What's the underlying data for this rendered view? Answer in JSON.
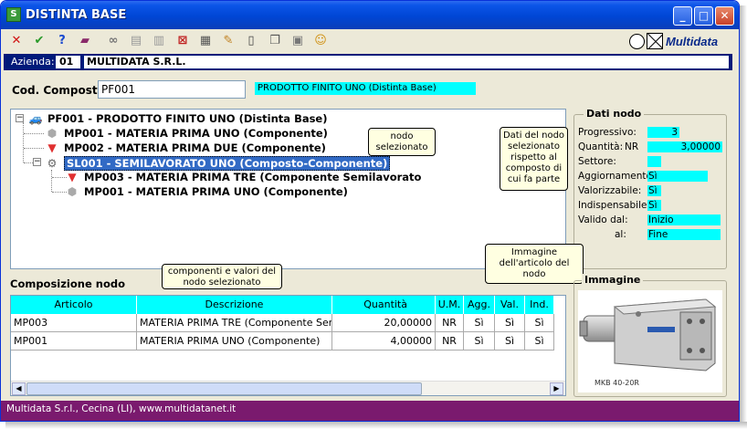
{
  "window": {
    "title": "DISTINTA BASE",
    "app_icon_letter": "S",
    "minimize": "_",
    "maximize": "□",
    "close": "✕"
  },
  "toolbar": {
    "icons": [
      "close-x-icon",
      "checkmark-icon",
      "help-icon",
      "book-icon",
      "binoculars-icon",
      "copy-icon",
      "paste-icon",
      "delete-icon",
      "print-preview-icon",
      "edit-icon",
      "new-document-icon",
      "duplicate-icon",
      "clipboard-icon",
      "palette-icon"
    ],
    "brand": "Multidata"
  },
  "azienda": {
    "label": "Azienda:",
    "code": "01",
    "name": "MULTIDATA S.R.L."
  },
  "composto": {
    "label": "Cod. Composto:",
    "value": "PF001",
    "description": "PRODOTTO FINITO UNO (Distinta Base)"
  },
  "tree": {
    "nodes": [
      {
        "label": "PF001 - PRODOTTO FINITO UNO (Distinta Base)",
        "icon": "car-icon"
      },
      {
        "label": "MP001 - MATERIA PRIMA UNO (Componente)",
        "icon": "cube-icon"
      },
      {
        "label": "MP002 - MATERIA PRIMA DUE (Componente)",
        "icon": "gem-icon"
      },
      {
        "label": "SL001 - SEMILAVORATO UNO (Composto-Componente)",
        "icon": "gear-icon"
      },
      {
        "label": "MP003 - MATERIA PRIMA TRE (Componente Semilavorato",
        "icon": "gem-icon"
      },
      {
        "label": "MP001 - MATERIA PRIMA UNO (Componente)",
        "icon": "cube-icon"
      }
    ],
    "callout": "nodo selezionato"
  },
  "dati_nodo": {
    "title": "Dati nodo",
    "callout": "Dati del nodo selezionato rispetto al composto di cui fa parte",
    "progressivo_label": "Progressivo:",
    "progressivo": "3",
    "quantita_label": "Quantità:",
    "um": "NR",
    "quantita": "3,00000",
    "settore_label": "Settore:",
    "settore": "",
    "aggiornamento_label": "Aggiornamento:",
    "aggiornamento": "Sì",
    "valorizzabile_label": "Valorizzabile:",
    "valorizzabile": "Sì",
    "indispensabile_label": "Indispensabile:",
    "indispensabile": "Sì",
    "valido_dal_label": "Valido dal:",
    "valido_dal": "Inizio",
    "al_label": "al:",
    "al": "Fine"
  },
  "composizione": {
    "title": "Composizione nodo",
    "callout": "componenti e valori del nodo selezionato",
    "columns": [
      "Articolo",
      "Descrizione",
      "Quantità",
      "U.M.",
      "Agg.",
      "Val.",
      "Ind."
    ],
    "rows": [
      [
        "MP003",
        "MATERIA PRIMA TRE (Componente Semila",
        "20,00000",
        "NR",
        "Sì",
        "Sì",
        "Sì"
      ],
      [
        "MP001",
        "MATERIA PRIMA UNO (Componente)",
        "4,00000",
        "NR",
        "Sì",
        "Sì",
        "Sì"
      ]
    ]
  },
  "immagine": {
    "title": "Immagine",
    "callout": "Immagine dell'articolo del nodo",
    "caption": "MKB 40-20R"
  },
  "footer": {
    "text": "Multidata S.r.l., Cecina (LI), www.multidatanet.it"
  }
}
